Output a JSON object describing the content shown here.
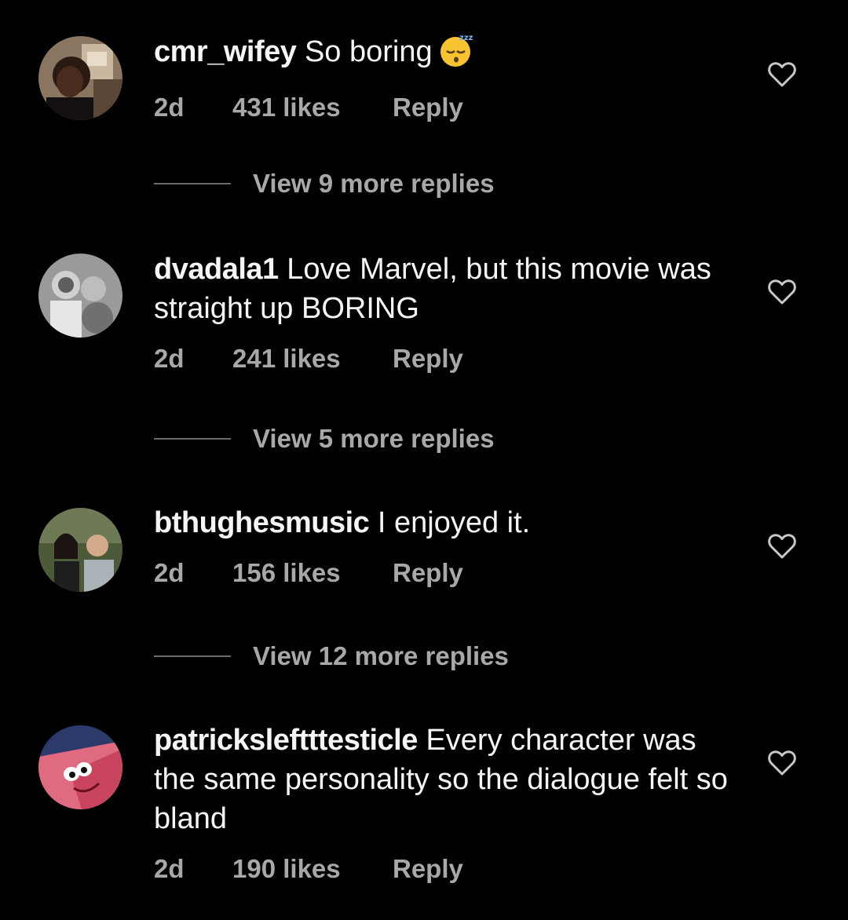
{
  "comments": [
    {
      "username": "cmr_wifey",
      "text": "So boring",
      "emoji": "sleeping-face-emoji",
      "time": "2d",
      "likes": "431 likes",
      "reply": "Reply",
      "view_replies": "View 9 more replies"
    },
    {
      "username": "dvadala1",
      "text": "Love Marvel, but this movie was straight up BORING",
      "time": "2d",
      "likes": "241 likes",
      "reply": "Reply",
      "view_replies": "View 5 more replies"
    },
    {
      "username": "bthughesmusic",
      "text": "I enjoyed it.",
      "time": "2d",
      "likes": "156 likes",
      "reply": "Reply",
      "view_replies": "View 12 more replies"
    },
    {
      "username": "patricksleftttesticle",
      "text": "Every character was the same personality so the dialogue felt so bland",
      "time": "2d",
      "likes": "190 likes",
      "reply": "Reply"
    }
  ],
  "colors": {
    "background": "#000000",
    "primary_text": "#f5f5f5",
    "secondary_text": "#a8a8a8"
  }
}
